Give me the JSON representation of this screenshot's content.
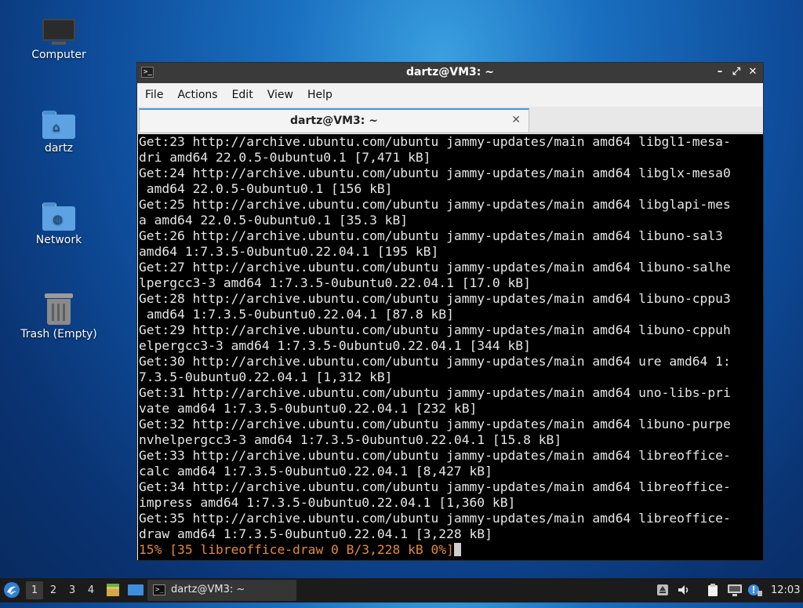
{
  "desktop": {
    "icons": [
      {
        "label": "Computer",
        "icon": "computer-icon"
      },
      {
        "label": "dartz",
        "icon": "home-folder-icon"
      },
      {
        "label": "Network",
        "icon": "network-folder-icon"
      },
      {
        "label": "Trash (Empty)",
        "icon": "trash-icon"
      }
    ]
  },
  "window": {
    "title": "dartz@VM3: ~",
    "controls": {
      "minimize": "–",
      "maximize": "⤢",
      "close": "✕"
    },
    "menu": [
      "File",
      "Actions",
      "Edit",
      "View",
      "Help"
    ],
    "tab": {
      "label": "dartz@VM3: ~",
      "close": "✕"
    }
  },
  "terminal": {
    "lines": [
      "Get:23 http://archive.ubuntu.com/ubuntu jammy-updates/main amd64 libgl1-mesa-",
      "dri amd64 22.0.5-0ubuntu0.1 [7,471 kB]",
      "Get:24 http://archive.ubuntu.com/ubuntu jammy-updates/main amd64 libglx-mesa0",
      " amd64 22.0.5-0ubuntu0.1 [156 kB]",
      "Get:25 http://archive.ubuntu.com/ubuntu jammy-updates/main amd64 libglapi-mes",
      "a amd64 22.0.5-0ubuntu0.1 [35.3 kB]",
      "Get:26 http://archive.ubuntu.com/ubuntu jammy-updates/main amd64 libuno-sal3",
      "amd64 1:7.3.5-0ubuntu0.22.04.1 [195 kB]",
      "Get:27 http://archive.ubuntu.com/ubuntu jammy-updates/main amd64 libuno-salhe",
      "lpergcc3-3 amd64 1:7.3.5-0ubuntu0.22.04.1 [17.0 kB]",
      "Get:28 http://archive.ubuntu.com/ubuntu jammy-updates/main amd64 libuno-cppu3",
      " amd64 1:7.3.5-0ubuntu0.22.04.1 [87.8 kB]",
      "Get:29 http://archive.ubuntu.com/ubuntu jammy-updates/main amd64 libuno-cppuh",
      "elpergcc3-3 amd64 1:7.3.5-0ubuntu0.22.04.1 [344 kB]",
      "Get:30 http://archive.ubuntu.com/ubuntu jammy-updates/main amd64 ure amd64 1:",
      "7.3.5-0ubuntu0.22.04.1 [1,312 kB]",
      "Get:31 http://archive.ubuntu.com/ubuntu jammy-updates/main amd64 uno-libs-pri",
      "vate amd64 1:7.3.5-0ubuntu0.22.04.1 [232 kB]",
      "Get:32 http://archive.ubuntu.com/ubuntu jammy-updates/main amd64 libuno-purpe",
      "nvhelpergcc3-3 amd64 1:7.3.5-0ubuntu0.22.04.1 [15.8 kB]",
      "Get:33 http://archive.ubuntu.com/ubuntu jammy-updates/main amd64 libreoffice-",
      "calc amd64 1:7.3.5-0ubuntu0.22.04.1 [8,427 kB]",
      "Get:34 http://archive.ubuntu.com/ubuntu jammy-updates/main amd64 libreoffice-",
      "impress amd64 1:7.3.5-0ubuntu0.22.04.1 [1,360 kB]",
      "Get:35 http://archive.ubuntu.com/ubuntu jammy-updates/main amd64 libreoffice-",
      "draw amd64 1:7.3.5-0ubuntu0.22.04.1 [3,228 kB]"
    ],
    "progress_line": "15% [35 libreoffice-draw 0 B/3,228 kB 0%]"
  },
  "taskbar": {
    "workspaces": [
      "1",
      "2",
      "3",
      "4"
    ],
    "active_workspace": "1",
    "task_title": "dartz@VM3: ~",
    "clock": "12:03"
  }
}
